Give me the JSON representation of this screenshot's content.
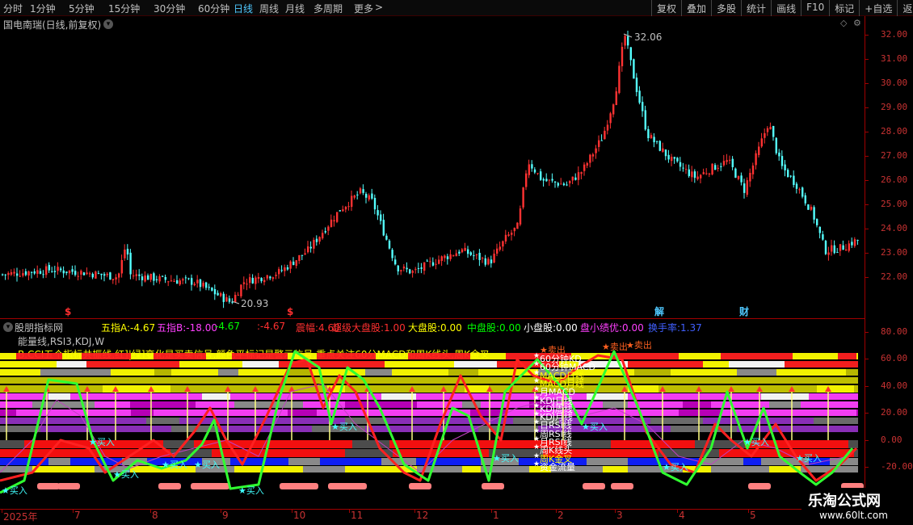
{
  "toolbar": {
    "periods": [
      "分时",
      "1分钟",
      "5分钟",
      "15分钟",
      "30分钟",
      "60分钟",
      "日线",
      "周线",
      "月线",
      "多周期",
      "更多"
    ],
    "active_period": "日线",
    "more_arrow": ">",
    "buttons": [
      "复权",
      "叠加",
      "多股",
      "统计",
      "画线",
      "F10",
      "标记",
      "+自选",
      "返回"
    ]
  },
  "main": {
    "title": "国电南瑞(日线,前复权)",
    "high_label": "32.06",
    "low_label": "20.93",
    "price_axis": [
      "32.00",
      "31.00",
      "30.00",
      "29.00",
      "28.00",
      "27.00",
      "26.00",
      "25.00",
      "24.00",
      "23.00",
      "22.00"
    ],
    "markers": [
      {
        "text": "$",
        "color": "#ff3030"
      },
      {
        "text": "$",
        "color": "#ff3030"
      },
      {
        "text": "解",
        "color": "#4fc8ff"
      },
      {
        "text": "财",
        "color": "#4fc8ff"
      }
    ]
  },
  "indicator": {
    "panel_title": "股朋指标网",
    "header": [
      {
        "label": "五指A:",
        "value": "-4.67",
        "color": "#ffff00"
      },
      {
        "label": "五指B:",
        "value": "-18.00",
        "color": "#ff40ff"
      },
      {
        "label": "",
        "value": "-4.67",
        "color": "#00ff00"
      },
      {
        "label": ":",
        "value": "-4.67",
        "color": "#ff3030"
      },
      {
        "label": "震幅:",
        "value": "4.60",
        "color": "#ff3030"
      },
      {
        "label": "超级大盘股:",
        "value": "1.00",
        "color": "#ff3030"
      },
      {
        "label": "大盘股:",
        "value": "0.00",
        "color": "#ffff00"
      },
      {
        "label": "中盘股:",
        "value": "0.00",
        "color": "#00ff00"
      },
      {
        "label": "小盘股:",
        "value": "0.00",
        "color": "#ffffff"
      },
      {
        "label": "盘小绩优:",
        "value": "0.00",
        "color": "#ff40ff"
      },
      {
        "label": "换手率:",
        "value": "1.37",
        "color": "#4060ff"
      }
    ],
    "sub_line1": "能量线,RSI3,KDJ,W",
    "sub_line2": "B.CCI五个指标共振线,红]|绿]变化是买卖信号,颜色平标记是警示信号,重点关注60分MACD和周K线头,周K金叉",
    "axis": [
      "80.00",
      "60.00",
      "40.00",
      "20.00",
      "0.00",
      "-20.00"
    ],
    "row_labels": [
      "60分钟KD",
      "60分钟MACD",
      "MACD日线",
      "MACD月线",
      "月MACD",
      "KDJ日线",
      "KDJ周线",
      "KDJ月线",
      "日RSI线",
      "周RSI线",
      "月RSI线",
      "周K线头",
      "周K金叉",
      "资金流量"
    ],
    "buy_label": "买入",
    "sell_label": "卖出"
  },
  "date_axis": [
    "2025年",
    "7",
    "8",
    "9",
    "10",
    "11",
    "12",
    "1",
    "2",
    "3",
    "4",
    "5"
  ],
  "watermark": {
    "title": "乐淘公式网",
    "url": "www.60lt.com"
  },
  "colors": {
    "up": "#ff3232",
    "down": "#54ffff",
    "axis": "#c83232",
    "bg": "#000000"
  }
}
